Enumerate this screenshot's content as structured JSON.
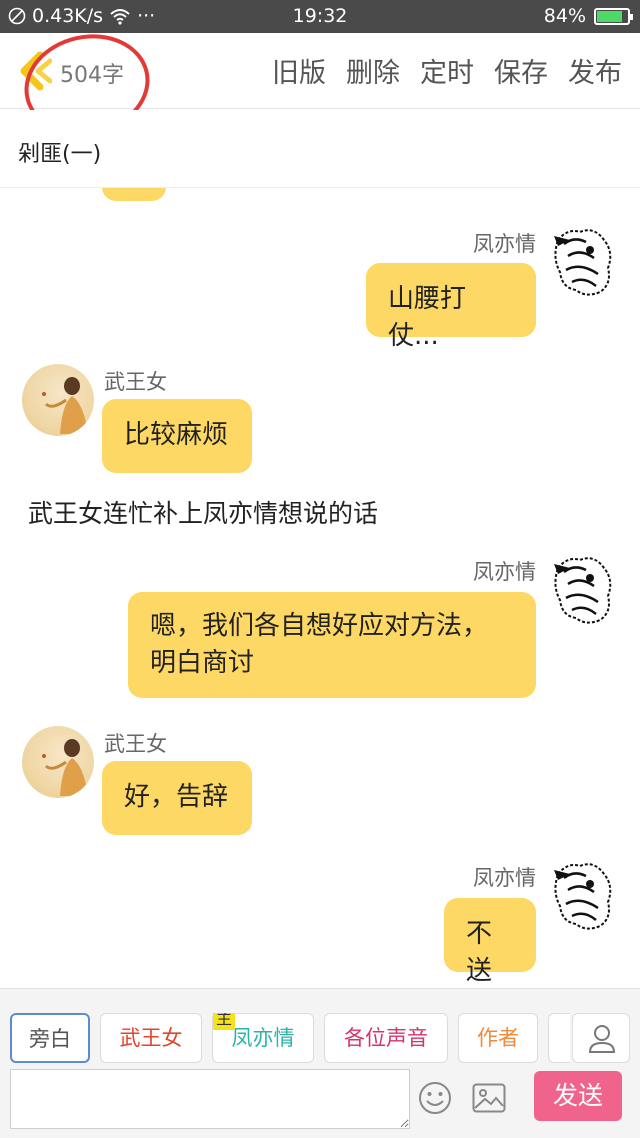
{
  "status_bar": {
    "network_speed": "0.43K/s",
    "dots": "···",
    "time": "19:32",
    "battery": "84%",
    "battery_level": 0.84
  },
  "toolbar": {
    "word_count": "504字",
    "actions": [
      "旧版",
      "删除",
      "定时",
      "保存",
      "发布"
    ]
  },
  "title": "剁匪(一)",
  "messages": [
    {
      "side": "right",
      "name": "凤亦情",
      "lines": [
        "山腰打仗..."
      ]
    },
    {
      "side": "left",
      "name": "武王女",
      "lines": [
        "比较麻烦"
      ]
    },
    {
      "side": "narration",
      "lines": [
        "武王女连忙补上凤亦情想说的话"
      ]
    },
    {
      "side": "right",
      "name": "凤亦情",
      "lines": [
        "嗯，我们各自想好应对方法，",
        "明白商讨"
      ]
    },
    {
      "side": "left",
      "name": "武王女",
      "lines": [
        "好，告辞"
      ]
    },
    {
      "side": "right",
      "name": "凤亦情",
      "lines": [
        "不送"
      ]
    }
  ],
  "roles": [
    {
      "label": "旁白",
      "color": "#555555",
      "active": true
    },
    {
      "label": "武王女",
      "color": "#e0452c",
      "active": false
    },
    {
      "label": "凤亦情",
      "color": "#2bb3a6",
      "active": false,
      "tag": "主"
    },
    {
      "label": "各位声音",
      "color": "#d6336c",
      "active": false
    },
    {
      "label": "作者",
      "color": "#f08a3c",
      "active": false
    }
  ],
  "composer": {
    "input_value": "",
    "send_label": "发送"
  },
  "colors": {
    "bubble": "#fdd865",
    "send": "#f0648c",
    "annotation": "#e53935"
  }
}
